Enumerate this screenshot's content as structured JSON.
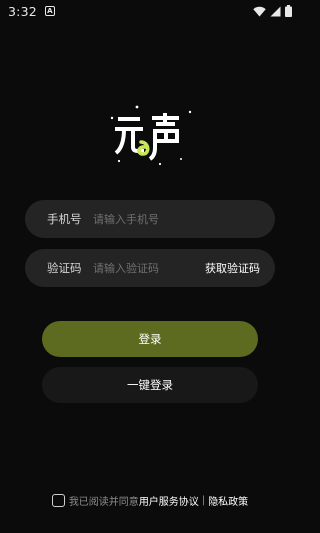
{
  "status_bar": {
    "time": "3:32",
    "notification_icon": "A"
  },
  "logo": {
    "text": "元声",
    "accent_color": "#c8e65a"
  },
  "form": {
    "phone": {
      "label": "手机号",
      "placeholder": "请输入手机号",
      "value": ""
    },
    "code": {
      "label": "验证码",
      "placeholder": "请输入验证码",
      "value": "",
      "get_code_label": "获取验证码"
    }
  },
  "buttons": {
    "login_label": "登录",
    "one_key_label": "一键登录"
  },
  "agreement": {
    "prefix": "我已阅读并同意",
    "user_agreement": "用户服务协议",
    "separator": "|",
    "privacy_policy": "隐私政策",
    "checked": false
  },
  "colors": {
    "background": "#0b0b0b",
    "field_bg": "#242424",
    "primary_button": "#5c6b1f",
    "secondary_button": "#181818"
  }
}
